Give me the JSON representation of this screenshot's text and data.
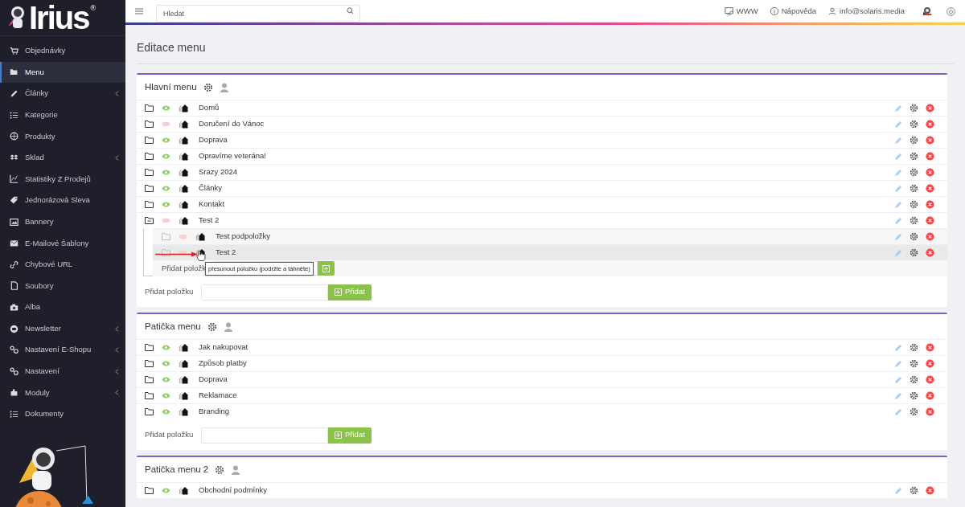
{
  "logo": {
    "text": "Irius",
    "mark": "®"
  },
  "sidebar": {
    "items": [
      {
        "label": "Objednávky",
        "selected": false,
        "submenu": false
      },
      {
        "label": "Menu",
        "selected": true,
        "submenu": false
      },
      {
        "label": "Články",
        "selected": false,
        "submenu": true
      },
      {
        "label": "Kategorie",
        "selected": false,
        "submenu": false
      },
      {
        "label": "Produkty",
        "selected": false,
        "submenu": false
      },
      {
        "label": "Sklad",
        "selected": false,
        "submenu": true
      },
      {
        "label": "Statistiky Z Prodejů",
        "selected": false,
        "submenu": false
      },
      {
        "label": "Jednorázová Sleva",
        "selected": false,
        "submenu": false
      },
      {
        "label": "Bannery",
        "selected": false,
        "submenu": false
      },
      {
        "label": "E-Mailové Šablony",
        "selected": false,
        "submenu": false
      },
      {
        "label": "Chybové URL",
        "selected": false,
        "submenu": false
      },
      {
        "label": "Soubory",
        "selected": false,
        "submenu": false
      },
      {
        "label": "Alba",
        "selected": false,
        "submenu": false
      },
      {
        "label": "Newsletter",
        "selected": false,
        "submenu": true
      },
      {
        "label": "Nastavení E-Shopu",
        "selected": false,
        "submenu": true
      },
      {
        "label": "Nastavení",
        "selected": false,
        "submenu": true
      },
      {
        "label": "Moduly",
        "selected": false,
        "submenu": true
      },
      {
        "label": "Dokumenty",
        "selected": false,
        "submenu": false
      }
    ]
  },
  "topbar": {
    "search": {
      "placeholder": "Hledat"
    },
    "links": [
      "WWW",
      "Nápověda",
      "info@solaris.media"
    ]
  },
  "page_title": "Editace menu",
  "menus": [
    {
      "title": "Hlavní menu",
      "items": [
        {
          "label": "Domů",
          "visible": true,
          "expanded": false
        },
        {
          "label": "Doručení do Vánoc",
          "visible": false,
          "expanded": false
        },
        {
          "label": "Doprava",
          "visible": true,
          "expanded": false
        },
        {
          "label": "Opravíme veterána!",
          "visible": true,
          "expanded": false
        },
        {
          "label": "Srazy 2024",
          "visible": true,
          "expanded": false
        },
        {
          "label": "Články",
          "visible": true,
          "expanded": false
        },
        {
          "label": "Kontakt",
          "visible": true,
          "expanded": false
        },
        {
          "label": "Test 2",
          "visible": false,
          "expanded": true,
          "children": [
            {
              "label": "Test podpoložky",
              "visible": false,
              "hovered": false
            },
            {
              "label": "Test 2",
              "visible": false,
              "hovered": true
            }
          ],
          "add_label": "Přidat položk"
        }
      ],
      "add_label": "Přidat položku",
      "add_button": "Přidat"
    },
    {
      "title": "Patička menu",
      "items": [
        {
          "label": "Jak nakupovat",
          "visible": true,
          "expanded": false
        },
        {
          "label": "Způsob platby",
          "visible": true,
          "expanded": false
        },
        {
          "label": "Doprava",
          "visible": true,
          "expanded": false
        },
        {
          "label": "Reklamace",
          "visible": true,
          "expanded": false
        },
        {
          "label": "Branding",
          "visible": true,
          "expanded": false
        }
      ],
      "add_label": "Přidat položku",
      "add_button": "Přidat"
    },
    {
      "title": "Patička menu 2",
      "items": [
        {
          "label": "Obchodní podmínky",
          "visible": true,
          "expanded": false
        }
      ]
    }
  ],
  "tooltip": "přesunout položku (podržte a táhněte)"
}
